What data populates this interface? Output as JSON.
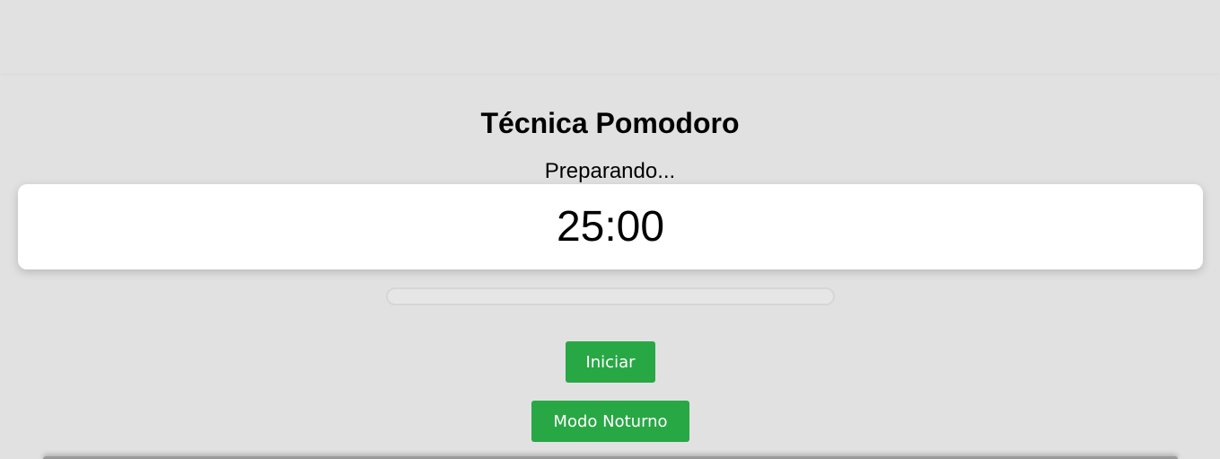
{
  "app": {
    "title": "Técnica Pomodoro",
    "status": "Preparando...",
    "timer": "25:00"
  },
  "progress": {
    "fraction": 0.0
  },
  "buttons": {
    "start_label": "Iniciar",
    "night_mode_label": "Modo Noturno"
  },
  "colors": {
    "background": "#e1e1e1",
    "card": "#ffffff",
    "button": "#28a745",
    "button_text": "#ffffff"
  }
}
